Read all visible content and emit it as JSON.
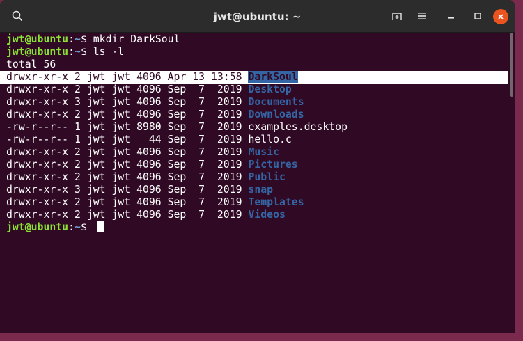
{
  "window": {
    "title": "jwt@ubuntu: ~",
    "icons": [
      "search-icon",
      "new-tab-icon",
      "menu-icon",
      "minimize-icon",
      "maximize-icon",
      "close-icon"
    ],
    "accent": "#e95420"
  },
  "prompt": {
    "user": "jwt@ubuntu",
    "sep": ":",
    "path": "~",
    "sign": "$ "
  },
  "commands": [
    "mkdir DarkSoul",
    "ls -l"
  ],
  "total": "total 56",
  "listing": [
    {
      "meta": "drwxr-xr-x 2 jwt jwt 4096 Apr 13 13:58 ",
      "name": "DarkSoul",
      "type": "dir",
      "selected": true
    },
    {
      "meta": "drwxr-xr-x 2 jwt jwt 4096 Sep  7  2019 ",
      "name": "Desktop",
      "type": "dir"
    },
    {
      "meta": "drwxr-xr-x 3 jwt jwt 4096 Sep  7  2019 ",
      "name": "Documents",
      "type": "dir"
    },
    {
      "meta": "drwxr-xr-x 2 jwt jwt 4096 Sep  7  2019 ",
      "name": "Downloads",
      "type": "dir"
    },
    {
      "meta": "-rw-r--r-- 1 jwt jwt 8980 Sep  7  2019 ",
      "name": "examples.desktop",
      "type": "file"
    },
    {
      "meta": "-rw-r--r-- 1 jwt jwt   44 Sep  7  2019 ",
      "name": "hello.c",
      "type": "file"
    },
    {
      "meta": "drwxr-xr-x 2 jwt jwt 4096 Sep  7  2019 ",
      "name": "Music",
      "type": "dir"
    },
    {
      "meta": "drwxr-xr-x 2 jwt jwt 4096 Sep  7  2019 ",
      "name": "Pictures",
      "type": "dir"
    },
    {
      "meta": "drwxr-xr-x 2 jwt jwt 4096 Sep  7  2019 ",
      "name": "Public",
      "type": "dir"
    },
    {
      "meta": "drwxr-xr-x 3 jwt jwt 4096 Sep  7  2019 ",
      "name": "snap",
      "type": "dir"
    },
    {
      "meta": "drwxr-xr-x 2 jwt jwt 4096 Sep  7  2019 ",
      "name": "Templates",
      "type": "dir"
    },
    {
      "meta": "drwxr-xr-x 2 jwt jwt 4096 Sep  7  2019 ",
      "name": "Videos",
      "type": "dir"
    }
  ]
}
